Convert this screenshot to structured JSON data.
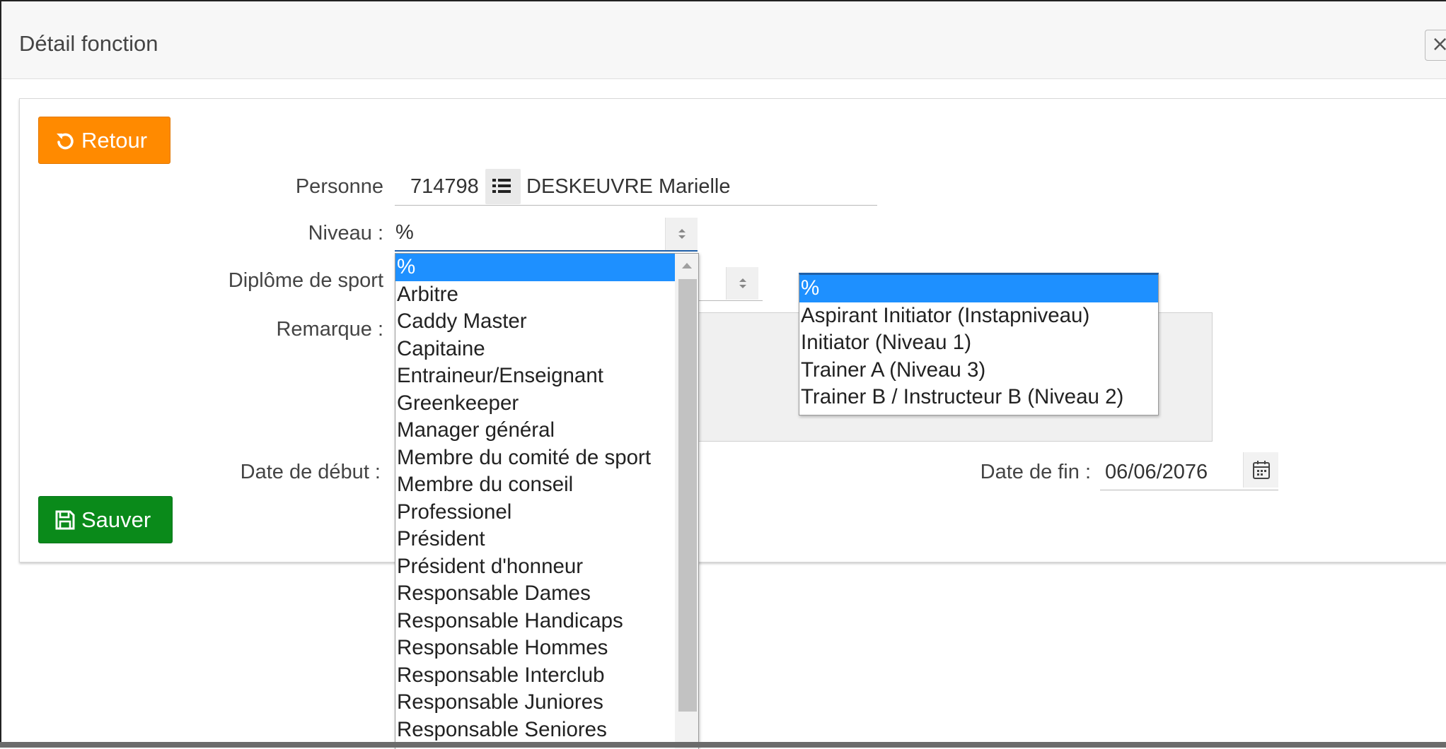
{
  "dialog": {
    "title": "Détail fonction",
    "close_label": "×"
  },
  "buttons": {
    "retour": "Retour",
    "sauver": "Sauver"
  },
  "labels": {
    "personne": "Personne",
    "niveau": "Niveau :",
    "diplome": "Diplôme de sport",
    "remarque": "Remarque :",
    "date_debut": "Date de début :",
    "date_fin": "Date de fin :"
  },
  "fields": {
    "personne_id": "714798",
    "personne_name": "DESKEUVRE Marielle",
    "niveau_value": "%",
    "date_fin_value": "06/06/2076"
  },
  "niveau_options": [
    "%",
    "Arbitre",
    "Caddy Master",
    "Capitaine",
    "Entraineur/Enseignant",
    "Greenkeeper",
    "Manager général",
    "Membre du comité de sport",
    "Membre du conseil",
    "Professionel",
    "Président",
    "Président d'honneur",
    "Responsable Dames",
    "Responsable Handicaps",
    "Responsable Hommes",
    "Responsable Interclub",
    "Responsable Juniores",
    "Responsable Seniores"
  ],
  "niveau_selected_index": 0,
  "diplome_options": [
    "%",
    "Aspirant Initiator (Instapniveau)",
    "Initiator (Niveau 1)",
    "Trainer A (Niveau 3)",
    "Trainer B / Instructeur B (Niveau 2)"
  ],
  "diplome_selected_index": 0,
  "colors": {
    "retour_button": "#ff8a00",
    "sauver_button": "#0a8a1a",
    "selected_option": "#1e90ff"
  },
  "icons": {
    "retour": "undo-icon",
    "sauver": "save-icon",
    "personne_list": "list-icon",
    "date_picker": "calendar-icon",
    "select_arrows": "sort-arrows-icon"
  }
}
